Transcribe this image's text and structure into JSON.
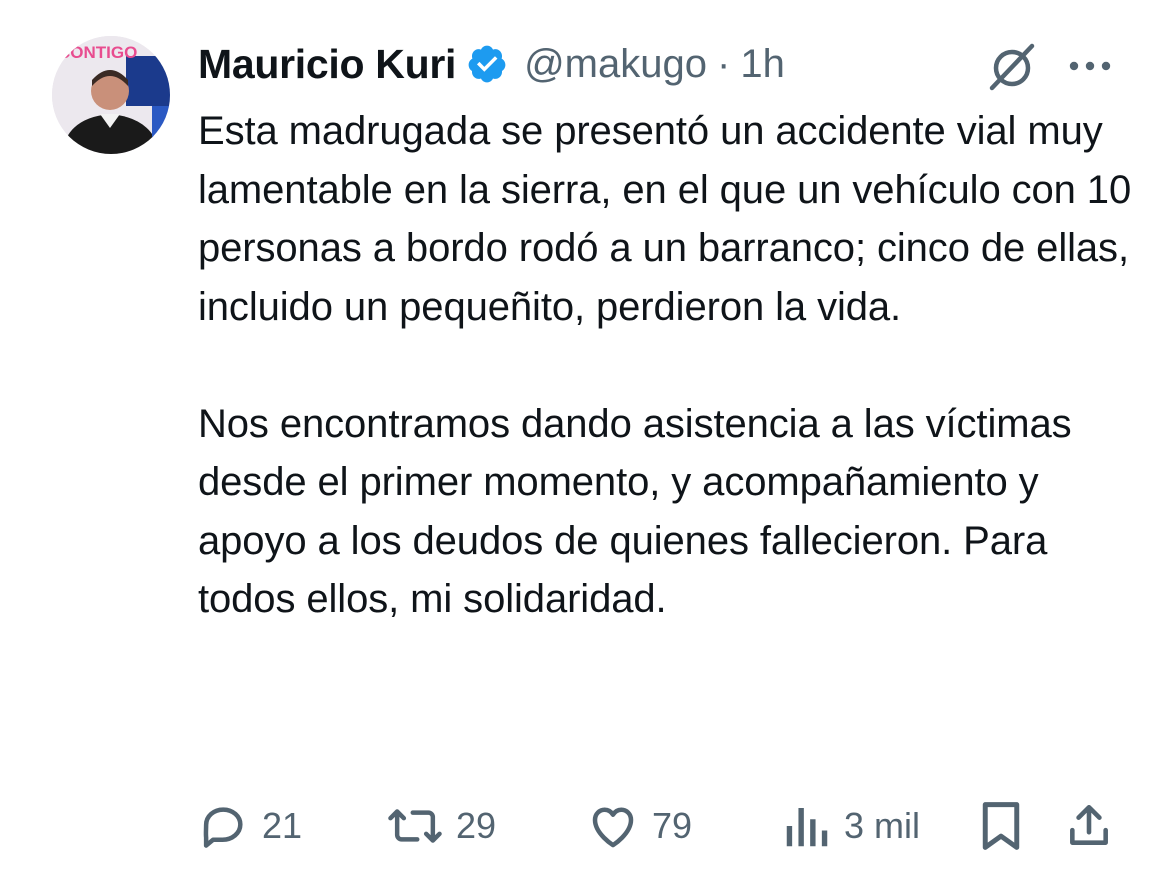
{
  "author": {
    "name": "Mauricio Kuri",
    "handle": "@makugo",
    "separator": "·",
    "time": "1h",
    "verified": true,
    "avatar_text": "CONTIGO"
  },
  "tweet": {
    "paragraphs": [
      "Esta madrugada se presentó un accidente vial muy lamentable en la sierra, en el que un vehículo con 10 personas a bordo rodó a un barranco; cinco de ellas, incluido un pequeñito, perdieron la vida.",
      "Nos encontramos dando asistencia a las víctimas desde el primer momento, y acompañamiento y apoyo a los deudos de quienes fallecieron. Para todos ellos, mi solidaridad."
    ]
  },
  "actions": {
    "replies": "21",
    "reposts": "29",
    "likes": "79",
    "views": "3 mil"
  },
  "icons": {
    "verified": "verified-badge-icon",
    "grok": "grok-icon",
    "more": "more-icon",
    "reply": "reply-icon",
    "repost": "repost-icon",
    "like": "heart-icon",
    "views": "views-icon",
    "bookmark": "bookmark-icon",
    "share": "share-icon"
  },
  "colors": {
    "text": "#0f1419",
    "secondary": "#536471",
    "verified": "#1d9bf0",
    "background": "#ffffff"
  }
}
